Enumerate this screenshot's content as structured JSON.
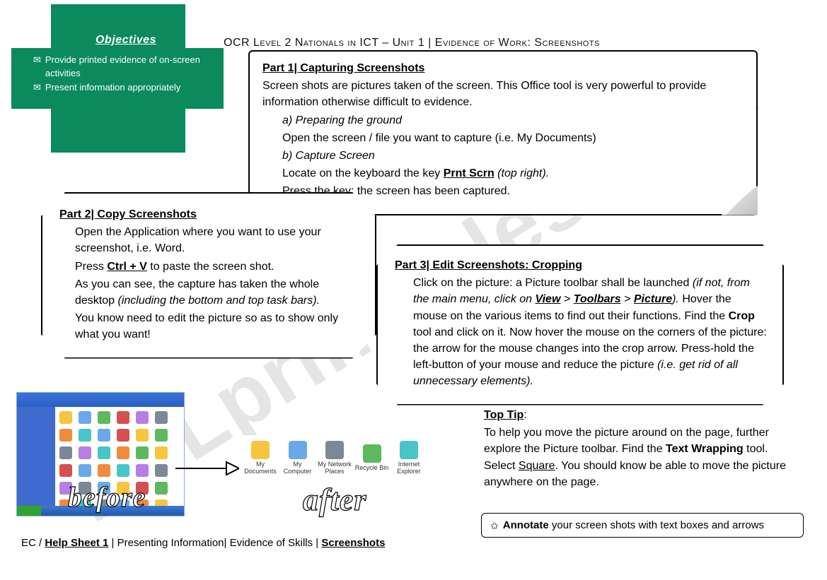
{
  "header": "OCR Level 2 Nationals in ICT – Unit 1 | Evidence of Work: Screenshots",
  "objectives": {
    "title": "Objectives",
    "bullets": [
      "Provide printed evidence of on-screen activities",
      "Present information appropriately"
    ]
  },
  "part1": {
    "title": "Part 1| Capturing Screenshots",
    "intro": "Screen shots are pictures taken of the screen. This Office tool is very powerful to provide information otherwise difficult to evidence.",
    "a_label": "a)  Preparing the ground",
    "a_text": "Open the screen / file you want to capture (i.e. My Documents)",
    "b_label": "b)  Capture Screen",
    "b_text_pre": "Locate on the keyboard the key ",
    "b_key": "Prnt Scrn",
    "b_text_post": " (top right).",
    "b_text2": "Press the key: the screen has been captured."
  },
  "part2": {
    "title": "Part 2| Copy Screenshots",
    "l1": "Open the Application where you want to use your screenshot, i.e. Word.",
    "l2_pre": "Press ",
    "l2_key": "Ctrl + V",
    "l2_post": " to paste the screen shot.",
    "l3_pre": "As you can see, the capture has taken the whole desktop ",
    "l3_em": "(including the bottom and top task bars).",
    "l4": "You know need to edit the picture so as to show only what you want!"
  },
  "part3": {
    "title": "Part 3| Edit Screenshots: Cropping",
    "t1_pre": "Click on the picture: a Picture toolbar shall be launched ",
    "t1_em_pre": "(if not, from the main menu, click on ",
    "t1_view": "View",
    "t1_sep1": " > ",
    "t1_toolbars": "Toolbars",
    "t1_sep2": " > ",
    "t1_picture": "Picture",
    "t1_em_post": ").",
    "t2_pre": " Hover the mouse on the various items to find out their functions. Find the ",
    "t2_crop": "Crop",
    "t2_post": " tool and click on it. Now hover the mouse on the corners of the picture: the arrow for the mouse changes into the crop arrow. Press-hold the left-button of your mouse and reduce the picture ",
    "t2_em": "(i.e. get rid of all unnecessary elements)."
  },
  "tip": {
    "title": "Top Tip",
    "colon": ":",
    "body_pre": "To help you move the picture around on the page, further explore the Picture toolbar. Find the ",
    "text_wrapping": "Text Wrapping",
    "body_mid": " tool. Select ",
    "square": "Square",
    "body_post": ". You should know be able to move the picture anywhere on the page."
  },
  "annotate": {
    "bold": "Annotate",
    "rest": " your screen shots with text boxes and arrows"
  },
  "footer": {
    "pre": "EC / ",
    "help": "Help Sheet 1",
    "mid": " | Presenting Information| Evidence of Skills | ",
    "screenshots": "Screenshots"
  },
  "labels": {
    "before": "before",
    "after": "after"
  },
  "after_icons": [
    "My Documents",
    "My Computer",
    "My Network Places",
    "Recycle Bin",
    "Internet Explorer"
  ],
  "watermark": "ESLprintables.com"
}
